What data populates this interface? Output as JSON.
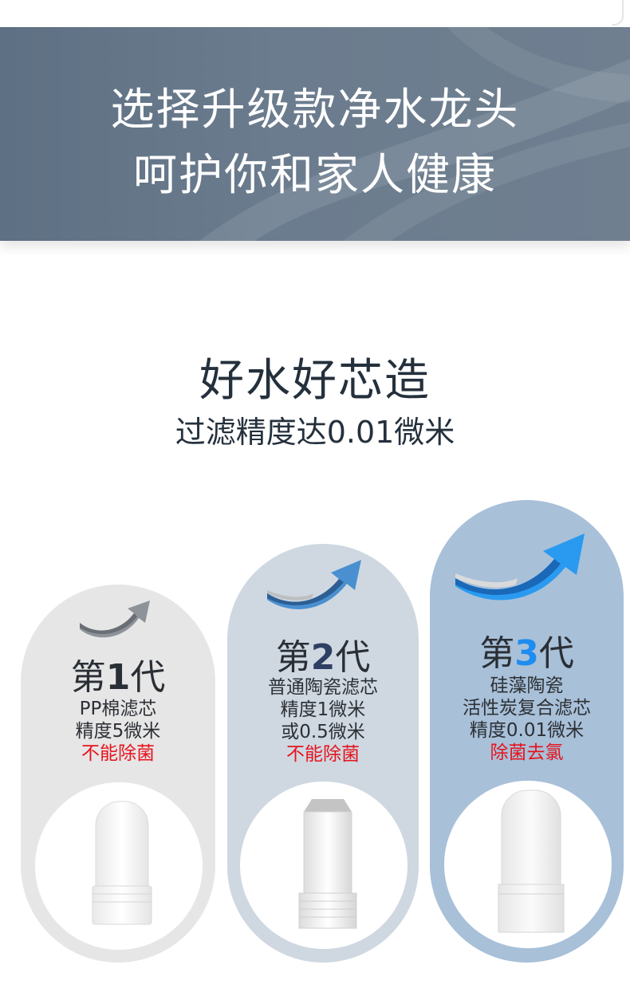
{
  "banner": {
    "line1": "选择升级款净水龙头",
    "line2": "呵护你和家人健康"
  },
  "section": {
    "title": "好水好芯造",
    "subtitle": "过滤精度达0.01微米"
  },
  "generations": [
    {
      "prefix": "第",
      "number": "1",
      "suffix": "代",
      "lines": [
        "PP棉滤芯",
        "精度5微米"
      ],
      "warning": "不能除菌",
      "arrow_icon": "grey-curved-arrow-icon",
      "filter_icon": "pp-cotton-filter-icon"
    },
    {
      "prefix": "第",
      "number": "2",
      "suffix": "代",
      "lines": [
        "普通陶瓷滤芯",
        "精度1微米",
        "或0.5微米"
      ],
      "warning": "不能除菌",
      "arrow_icon": "blue-curved-arrow-icon",
      "filter_icon": "ceramic-filter-icon"
    },
    {
      "prefix": "第",
      "number": "3",
      "suffix": "代",
      "lines": [
        "硅藻陶瓷",
        "活性炭复合滤芯",
        "精度0.01微米"
      ],
      "warning": "除菌去氯",
      "arrow_icon": "bright-blue-curved-arrow-icon",
      "filter_icon": "diatom-ceramic-filter-icon"
    }
  ],
  "colors": {
    "banner": "#667789",
    "card1": "#e6e6e6",
    "card2": "#cfd8e1",
    "card3": "#a8c0d8",
    "warning": "#e6141e",
    "highlight_number": "#1e8cf0"
  }
}
